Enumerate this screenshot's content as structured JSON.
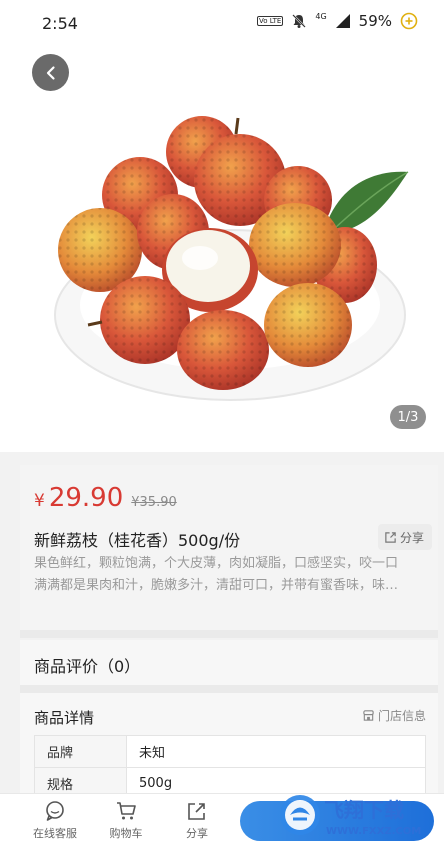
{
  "status_bar": {
    "time": "2:54",
    "network": "4G",
    "battery_percent": "59%",
    "volte_label": "Vo LTE"
  },
  "gallery": {
    "page_indicator": "1/3"
  },
  "product": {
    "currency_symbol": "¥",
    "price": "29.90",
    "original_price": "¥35.90",
    "title": "新鲜荔枝（桂花香）500g/份",
    "share_label": "分享",
    "description_line1": "果色鲜红，颗粒饱满，个大皮薄，肉如凝脂，口感坚实，咬一口",
    "description_line2": "满满都是果肉和汁，脆嫩多汁，清甜可口，并带有蜜香味，味…"
  },
  "reviews": {
    "title": "商品评价（0）"
  },
  "details": {
    "title": "商品详情",
    "store_info_label": "门店信息",
    "specs": [
      {
        "key": "品牌",
        "value": "未知"
      },
      {
        "key": "规格",
        "value": "500g"
      }
    ]
  },
  "bottom_nav": {
    "items": [
      {
        "label": "在线客服",
        "icon": "chat-icon"
      },
      {
        "label": "购物车",
        "icon": "cart-icon"
      },
      {
        "label": "分享",
        "icon": "share-icon"
      }
    ]
  },
  "watermark": {
    "brand": "飞翔下载",
    "url": "WWW.FXXZ.COM"
  },
  "colors": {
    "price_red": "#d83a33",
    "buy_button_blue": "#1e6fd9"
  }
}
